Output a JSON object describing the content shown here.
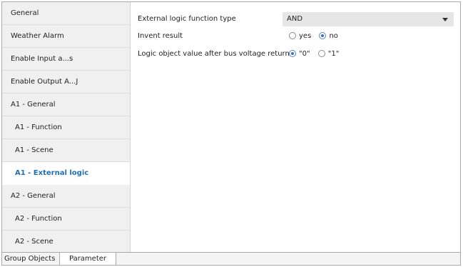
{
  "sidebar": {
    "items": [
      {
        "label": "General"
      },
      {
        "label": "Weather Alarm"
      },
      {
        "label": "Enable Input a...s"
      },
      {
        "label": "Enable Output A...J"
      },
      {
        "label": "A1 - General"
      },
      {
        "label": "A1 - Function"
      },
      {
        "label": "A1 - Scene"
      },
      {
        "label": "A1 - External logic",
        "active": true
      },
      {
        "label": "A2 - General"
      },
      {
        "label": "A2 - Function"
      },
      {
        "label": "A2 - Scene"
      }
    ]
  },
  "params": {
    "logic_type": {
      "label": "External logic function type",
      "value": "AND"
    },
    "invert_result": {
      "label": "Invent result",
      "options": [
        "yes",
        "no"
      ],
      "selected": "no"
    },
    "bus_return": {
      "label": "Logic object value after bus voltage return",
      "options": [
        "\"0\"",
        "\"1\""
      ],
      "selected": "\"0\""
    }
  },
  "tabs": {
    "group_objects": "Group Objects",
    "parameter": "Parameter"
  },
  "colors": {
    "accent": "#1d6fb8",
    "radio_fill": "#3d6fc4",
    "dropdown_bg": "#e6e6e6"
  }
}
